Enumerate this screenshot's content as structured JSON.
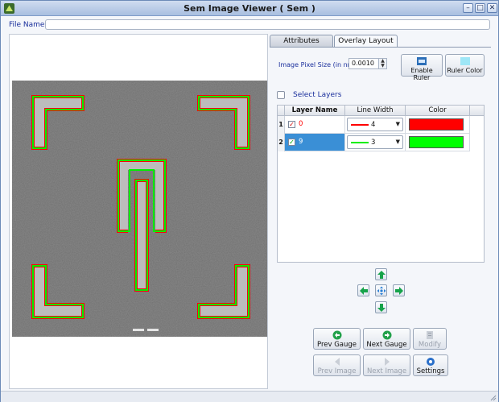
{
  "window": {
    "title": "Sem Image Viewer ( Sem )",
    "controls": [
      "–",
      "□",
      "✕"
    ]
  },
  "file": {
    "label": "File Name",
    "value": ""
  },
  "tabs": [
    {
      "label": "Attributes",
      "active": false
    },
    {
      "label": "Overlay Layout",
      "active": true
    }
  ],
  "pixel_size": {
    "label": "Image Pixel Size (in nm)",
    "value": "0.0010"
  },
  "buttons": {
    "enable_ruler": "Enable Ruler",
    "ruler_color": "Ruler Color"
  },
  "select_layers": {
    "label": "Select Layers",
    "checked": false
  },
  "table": {
    "headers": [
      "Layer Name",
      "Line Width",
      "Color"
    ],
    "rows": [
      {
        "index": "1",
        "checked": true,
        "check_mark": "✓",
        "name": "0",
        "width": "4",
        "color": "#ff0000",
        "selected": false
      },
      {
        "index": "2",
        "checked": true,
        "check_mark": "✓",
        "name": "9",
        "width": "3",
        "color": "#00ff00",
        "selected": true
      }
    ]
  },
  "navigation": {
    "up": "arrow-up-icon",
    "down": "arrow-down-icon",
    "left": "arrow-left-icon",
    "right": "arrow-right-icon",
    "center": "move-center-icon"
  },
  "actions": {
    "prev_gauge": "Prev Gauge",
    "next_gauge": "Next Gauge",
    "modify": "Modify",
    "prev_image": "Prev Image",
    "next_image": "Next Image",
    "settings": "Settings"
  },
  "colors": {
    "layer0": "#ff0000",
    "layer9": "#00ff00",
    "selection": "#3a8fd6",
    "nav_green": "#16a34a"
  }
}
